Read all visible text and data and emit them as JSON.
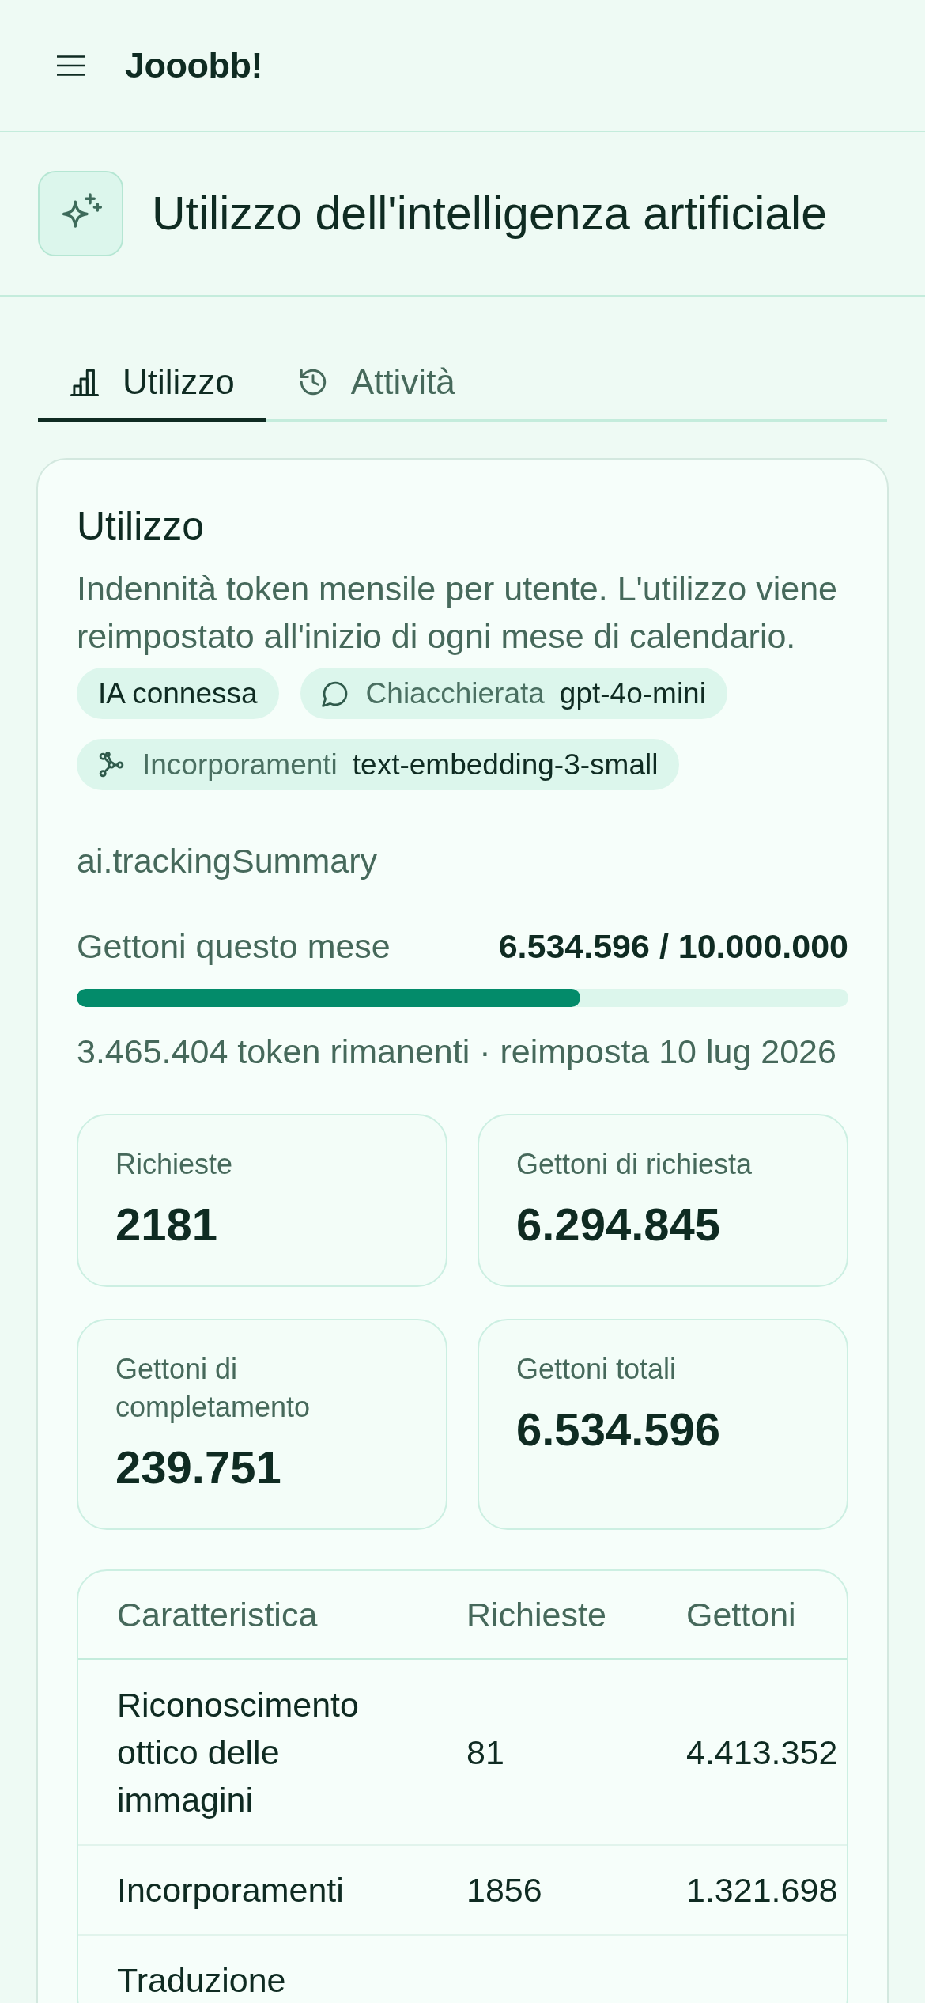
{
  "header": {
    "brand": "Jooobb!"
  },
  "page_title": "Utilizzo dell'intelligenza artificiale",
  "tabs": [
    {
      "label": "Utilizzo",
      "selected": true
    },
    {
      "label": "Attività",
      "selected": false
    }
  ],
  "usage": {
    "title": "Utilizzo",
    "description": "Indennità token mensile per utente. L'utilizzo viene reimpostato all'inizio di ogni mese di calendario.",
    "badges": [
      {
        "kind": "status",
        "label": "IA connessa"
      },
      {
        "kind": "model",
        "label": "Chiacchierata",
        "value": "gpt-4o-mini"
      },
      {
        "kind": "model",
        "label": "Incorporamenti",
        "value": "text-embedding-3-small"
      }
    ],
    "tracking_summary": "ai.trackingSummary",
    "quota": {
      "label": "Gettoni questo mese",
      "value": "6.534.596 / 10.000.000",
      "level": 0.653,
      "note": "3.465.404 token rimanenti · reimposta 10 lug 2026"
    },
    "stats": [
      {
        "label": "Richieste",
        "value": "2181"
      },
      {
        "label": "Gettoni di richiesta",
        "value": "6.294.845"
      },
      {
        "label": "Gettoni di completamento",
        "value": "239.751"
      },
      {
        "label": "Gettoni totali",
        "value": "6.534.596"
      }
    ],
    "table": {
      "columns": [
        "Caratteristica",
        "Richieste",
        "Gettoni"
      ],
      "rows": [
        [
          "Riconoscimento ottico delle immagini",
          "81",
          "4.413.352"
        ],
        [
          "Incorporamenti",
          "1856",
          "1.321.698"
        ],
        [
          "Traduzione"
        ]
      ]
    }
  }
}
